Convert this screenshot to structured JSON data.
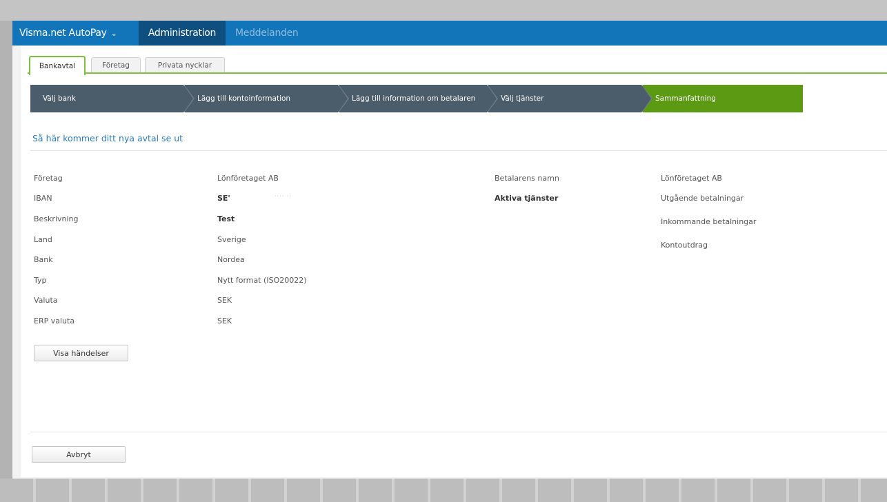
{
  "topbar": {
    "brand": "Visma.net AutoPay",
    "brand_chevron": "chevron-down-icon",
    "admin": "Administration",
    "messages": "Meddelanden"
  },
  "tabs": [
    {
      "label": "Bankavtal",
      "active": true
    },
    {
      "label": "Företag",
      "active": false
    },
    {
      "label": "Privata nycklar",
      "active": false
    }
  ],
  "wizard": {
    "steps": [
      {
        "label": "Välj bank"
      },
      {
        "label": "Lägg till kontoinformation"
      },
      {
        "label": "Lägg till information om betalaren"
      },
      {
        "label": "Välj tjänster"
      },
      {
        "label": "Sammanfattning",
        "active": true
      }
    ],
    "active_color": "#5b9a12",
    "step_color": "#4b5c6a"
  },
  "summary": {
    "title": "Så här kommer ditt nya avtal se ut",
    "left": [
      {
        "label": "Företag",
        "value": "Lönföretaget AB"
      },
      {
        "label": "IBAN",
        "value": "SE'",
        "masked": "···· ··"
      },
      {
        "label": "Beskrivning",
        "value": "Test"
      },
      {
        "label": "Land",
        "value": "Sverige"
      },
      {
        "label": "Bank",
        "value": "Nordea"
      },
      {
        "label": "Typ",
        "value": "Nytt format (ISO20022)"
      },
      {
        "label": "Valuta",
        "value": "SEK"
      },
      {
        "label": "ERP valuta",
        "value": "SEK"
      }
    ],
    "payer_name_label": "Betalarens namn",
    "payer_name_value": "Lönföretaget AB",
    "active_services_label": "Aktiva tjänster",
    "services": [
      "Utgående betalningar",
      "Inkommande betalningar",
      "Kontoutdrag"
    ]
  },
  "buttons": {
    "events": "Visa händelser",
    "cancel": "Avbryt"
  },
  "colors": {
    "topbar": "#1375b9",
    "topbar_active": "#0e4f7f",
    "link": "#2b7bc0",
    "accent_green": "#7cbf3c"
  }
}
